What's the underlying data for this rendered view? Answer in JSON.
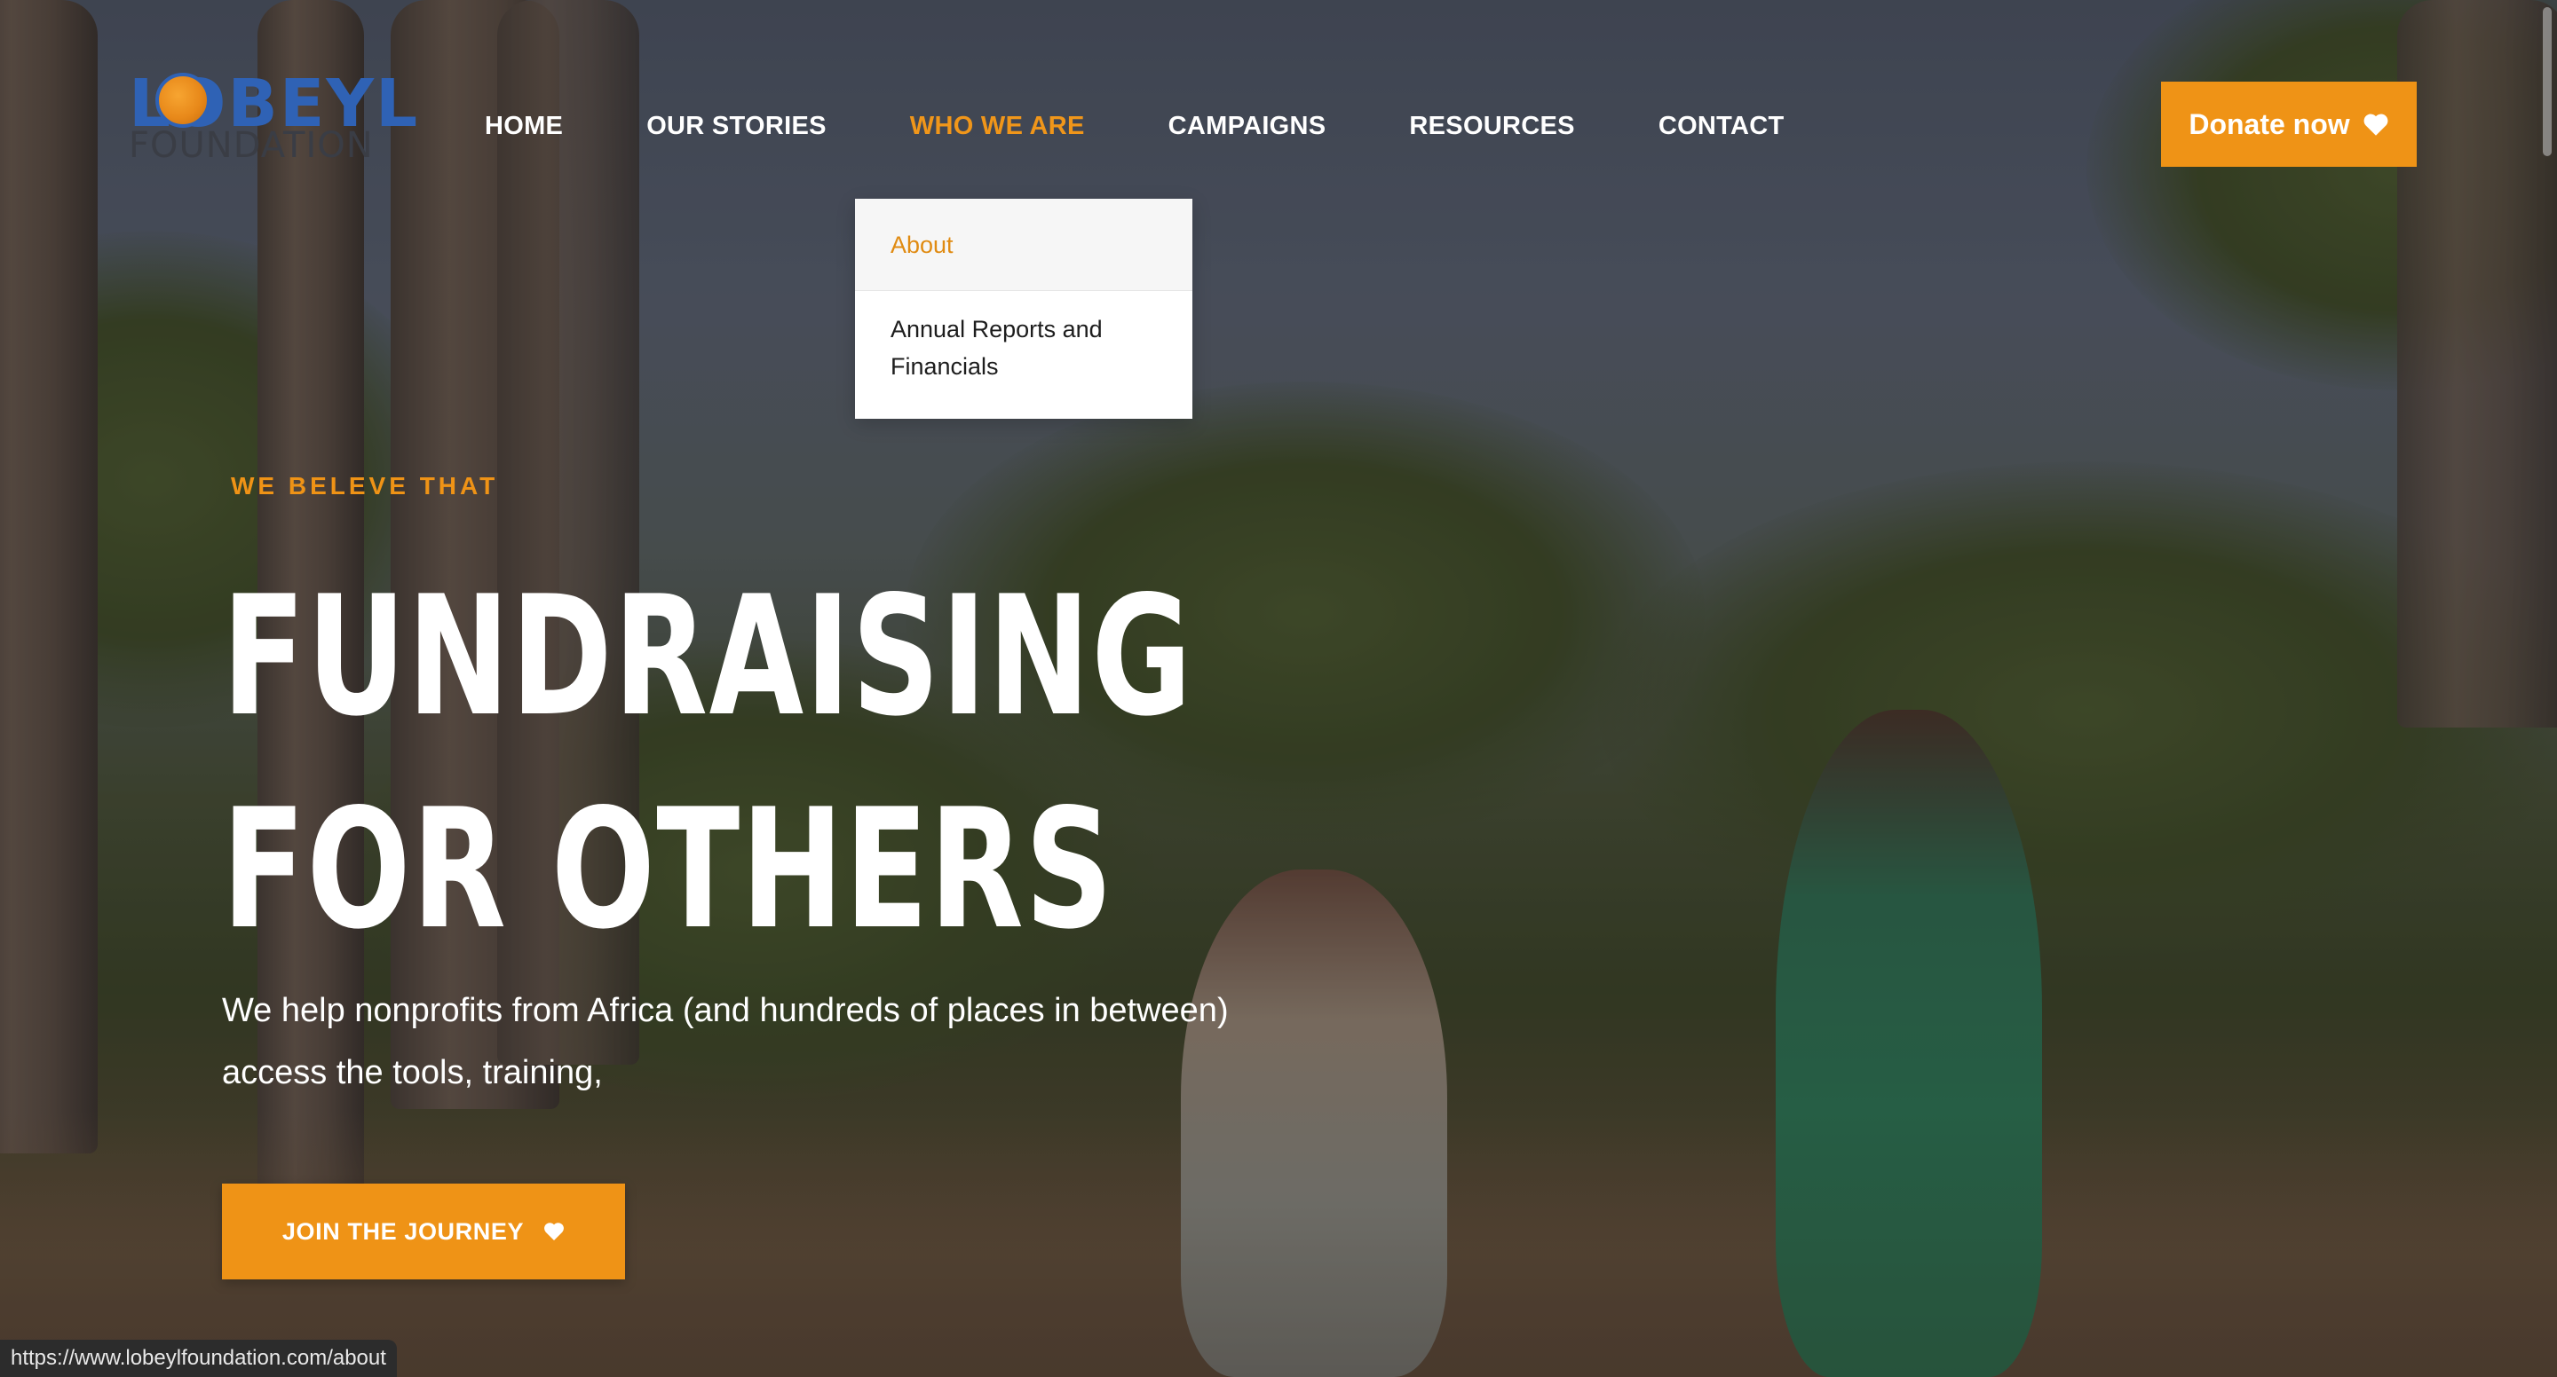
{
  "logo": {
    "wordmark_top": "LOBEYL",
    "wordmark_bottom": "FOUNDATION"
  },
  "nav": {
    "items": [
      {
        "label": "HOME",
        "active": false
      },
      {
        "label": "OUR STORIES",
        "active": false
      },
      {
        "label": "WHO WE ARE",
        "active": true
      },
      {
        "label": "CAMPAIGNS",
        "active": false
      },
      {
        "label": "RESOURCES",
        "active": false
      },
      {
        "label": "CONTACT",
        "active": false
      }
    ]
  },
  "donate_button": {
    "label": "Donate now",
    "icon": "heart-icon"
  },
  "dropdown": {
    "items": [
      {
        "label": "About",
        "highlighted": true
      },
      {
        "label": "Annual Reports and Financials",
        "highlighted": false
      }
    ]
  },
  "hero": {
    "eyebrow": "WE BELEVE THAT",
    "headline_line1": "FUNDRAISING",
    "headline_line2": "FOR OTHERS",
    "lead_line1": "We help nonprofits from Africa (and hundreds of places in between)",
    "lead_line2": "access the tools, training,",
    "cta": {
      "label": "JOIN THE JOURNEY",
      "icon": "heart-icon"
    }
  },
  "status_bar": {
    "url": "https://www.lobeylfoundation.com/about"
  },
  "colors": {
    "accent": "#ef9316",
    "text_light": "#ffffff",
    "logo_blue": "#2f62b5"
  }
}
